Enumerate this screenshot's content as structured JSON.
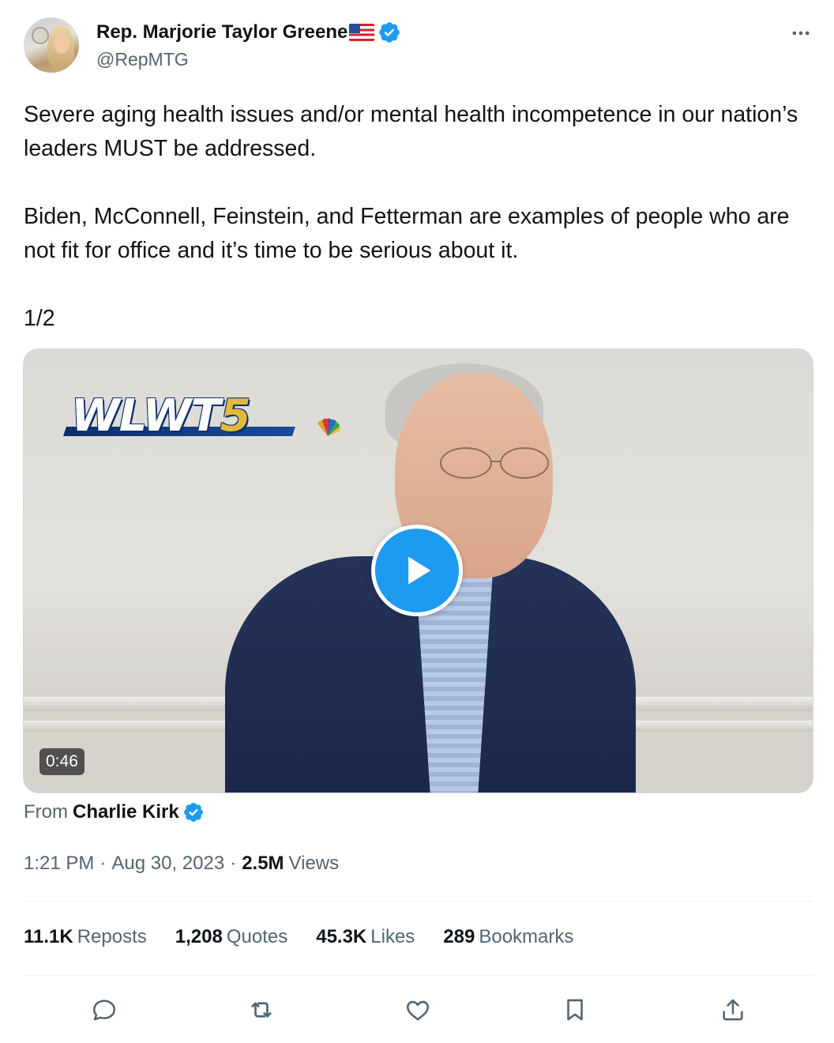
{
  "author": {
    "display_name": "Rep. Marjorie Taylor Greene",
    "handle": "@RepMTG"
  },
  "tweet": {
    "text": "Severe aging health issues and/or mental health incompetence in our nation’s leaders MUST be addressed.\n\nBiden, McConnell, Feinstein, and Fetterman are examples of people who are not fit for office and it’s time to be serious about it.\n\n1/2"
  },
  "media": {
    "logo_text": "WLWT",
    "logo_number": "5",
    "duration": "0:46"
  },
  "attribution": {
    "from_label": "From",
    "source_name": "Charlie Kirk"
  },
  "meta": {
    "time": "1:21 PM",
    "date": "Aug 30, 2023",
    "separator": "·",
    "views_count": "2.5M",
    "views_label": "Views"
  },
  "stats": [
    {
      "count": "11.1K",
      "label": "Reposts"
    },
    {
      "count": "1,208",
      "label": "Quotes"
    },
    {
      "count": "45.3K",
      "label": "Likes"
    },
    {
      "count": "289",
      "label": "Bookmarks"
    }
  ],
  "icons": {
    "more": "more-icon",
    "reply": "reply-icon",
    "repost": "repost-icon",
    "like": "like-icon",
    "bookmark": "bookmark-icon",
    "share": "share-icon"
  },
  "colors": {
    "accent": "#1d9bf0",
    "secondary_text": "#536471",
    "primary_text": "#0f1419"
  }
}
